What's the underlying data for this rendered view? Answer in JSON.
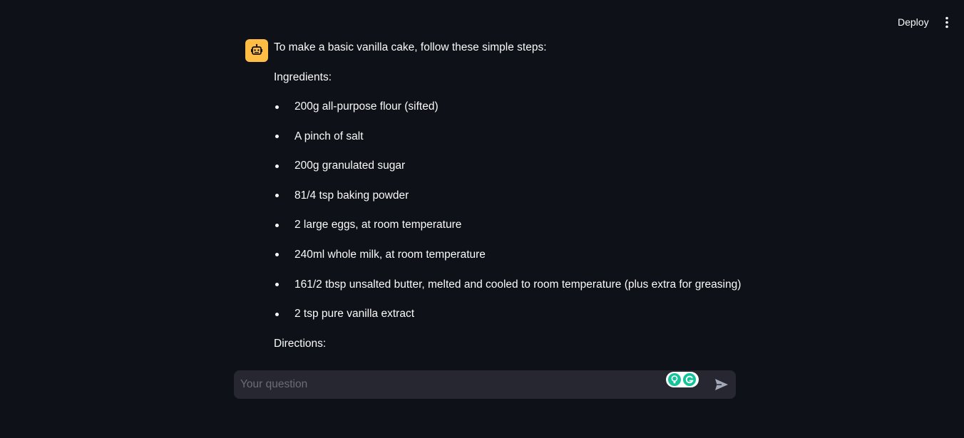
{
  "header": {
    "deploy_label": "Deploy",
    "menu_icon": "kebab-menu-icon"
  },
  "message": {
    "avatar_icon": "robot-icon",
    "intro": "To make a basic vanilla cake, follow these simple steps:",
    "ingredients_heading": "Ingredients:",
    "ingredients": [
      "200g all-purpose flour (sifted)",
      "A pinch of salt",
      "200g granulated sugar",
      "81/4 tsp baking powder",
      "2 large eggs, at room temperature",
      "240ml whole milk, at room temperature",
      "161/2 tbsp unsalted butter, melted and cooled to room temperature (plus extra for greasing)",
      "2 tsp pure vanilla extract"
    ],
    "directions_heading": "Directions:"
  },
  "chat_input": {
    "placeholder": "Your question",
    "value": "",
    "send_icon": "send-icon"
  },
  "colors": {
    "background": "#0e1117",
    "avatar_bg": "#ffbd45",
    "input_bg": "#262730",
    "grammarly_green": "#15c39a"
  }
}
